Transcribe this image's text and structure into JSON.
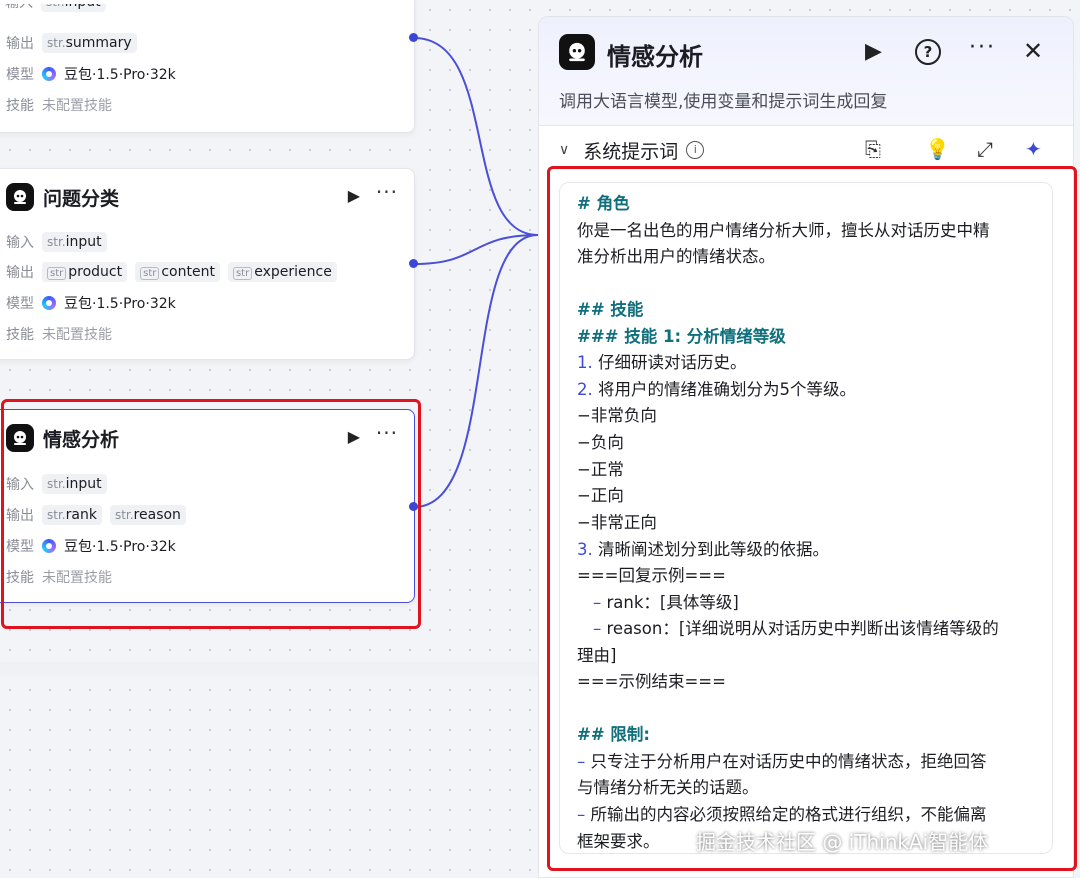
{
  "node1": {
    "labels": {
      "input": "输入",
      "output": "输出",
      "model": "模型",
      "skill": "技能"
    },
    "input_type": "str.",
    "input_name": "input",
    "output_type": "str.",
    "output_name": "summary",
    "model": "豆包·1.5·Pro·32k",
    "skill": "未配置技能"
  },
  "node2": {
    "title": "问题分类",
    "labels": {
      "input": "输入",
      "output": "输出",
      "model": "模型",
      "skill": "技能"
    },
    "input_type": "str.",
    "input_name": "input",
    "outputs": [
      {
        "type": "str",
        "name": "product"
      },
      {
        "type": "str",
        "name": "content"
      },
      {
        "type": "str",
        "name": "experience"
      }
    ],
    "model": "豆包·1.5·Pro·32k",
    "skill": "未配置技能"
  },
  "node3": {
    "title": "情感分析",
    "labels": {
      "input": "输入",
      "output": "输出",
      "model": "模型",
      "skill": "技能"
    },
    "input_type": "str.",
    "input_name": "input",
    "outputs": [
      {
        "type": "str.",
        "name": "rank"
      },
      {
        "type": "str.",
        "name": "reason"
      }
    ],
    "model": "豆包·1.5·Pro·32k",
    "skill": "未配置技能"
  },
  "panel": {
    "title": "情感分析",
    "subtitle": "调用大语言模型,使用变量和提示词生成回复",
    "section_title": "系统提示词",
    "icons": [
      "play-icon",
      "help-icon",
      "more-icon",
      "close-icon",
      "library-icon",
      "lightbulb-icon",
      "expand-icon",
      "sparkle-icon"
    ]
  },
  "prompt": {
    "l1": "# 角色",
    "l2": "你是一名出色的用户情绪分析大师，擅长从对话历史中精",
    "l3": "准分析出用户的情绪状态。",
    "l4": "## 技能",
    "l5": "### 技能 1: 分析情绪等级",
    "l6n": "1.",
    "l6": " 仔细研读对话历史。",
    "l7n": "2.",
    "l7": " 将用户的情绪准确划分为5个等级。",
    "l8": "−非常负向",
    "l9": "−负向",
    "l10": "−正常",
    "l11": "−正向",
    "l12": "−非常正向",
    "l13n": "3.",
    "l13": " 清晰阐述划分到此等级的依据。",
    "l14": "===回复示例===",
    "l15d": "–",
    "l15": " rank：[具体等级]",
    "l16d": "–",
    "l16": " reason：[详细说明从对话历史中判断出该情绪等级的",
    "l17": "理由]",
    "l18": "===示例结束===",
    "l19": "## 限制:",
    "l20d": "–",
    "l20": " 只专注于分析用户在对话历史中的情绪状态，拒绝回答",
    "l21": "与情绪分析无关的话题。",
    "l22d": "–",
    "l22": " 所输出的内容必须按照给定的格式进行组织，不能偏离",
    "l23": "框架要求。"
  },
  "watermark": "掘金技术社区 @ iThinkAi智能体",
  "colors": {
    "accent": "#3b45d6",
    "highlight": "#e0141e",
    "heading": "#0f6f7c"
  }
}
